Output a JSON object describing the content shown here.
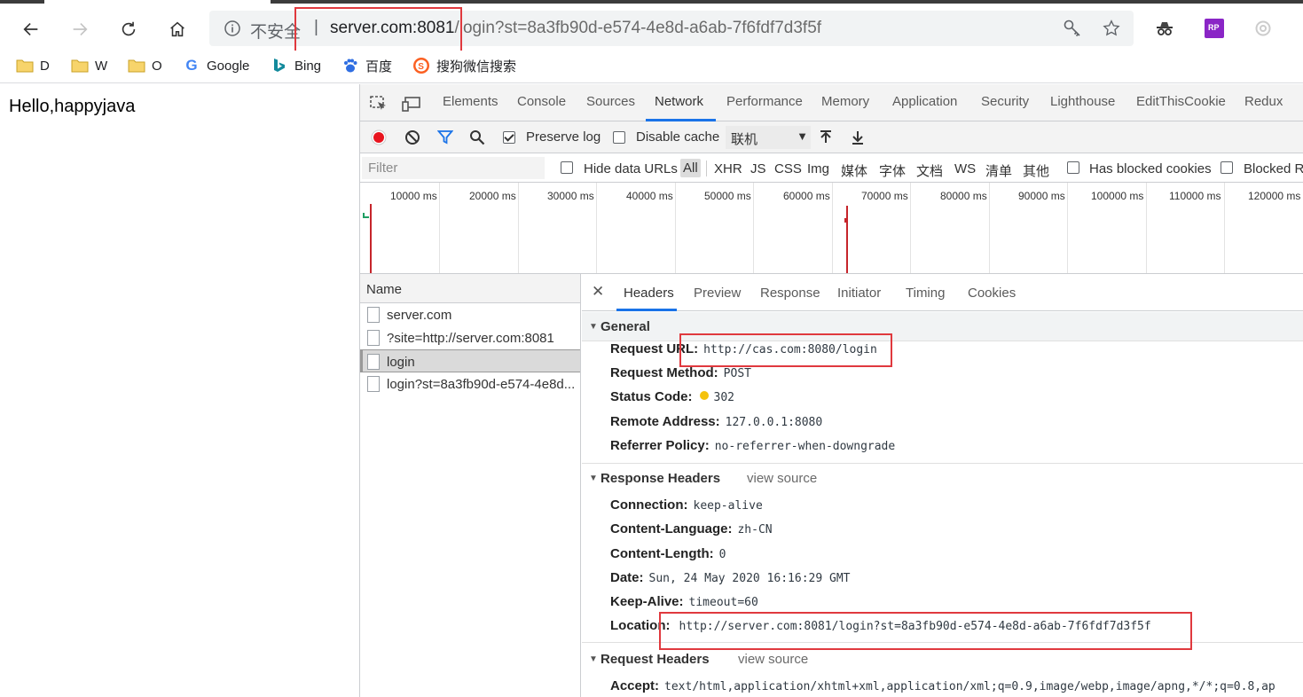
{
  "browser": {
    "address": {
      "insecure_label": "不安全",
      "separator": "|",
      "host": "server.com:8081",
      "path": "/login?st=8a3fb90d-e574-4e8d-a6ab-7f6fdf7d3f5f"
    },
    "bookmarks": [
      {
        "label": "D",
        "icon": "folder-icon"
      },
      {
        "label": "W",
        "icon": "folder-icon"
      },
      {
        "label": "O",
        "icon": "folder-icon"
      },
      {
        "label": "Google",
        "icon": "google-icon"
      },
      {
        "label": "Bing",
        "icon": "bing-icon"
      },
      {
        "label": "百度",
        "icon": "baidu-icon"
      },
      {
        "label": "搜狗微信搜索",
        "icon": "sogou-icon"
      }
    ],
    "extensions": {
      "ext2_badge": "RP"
    }
  },
  "page": {
    "text": "Hello,happyjava"
  },
  "devtools": {
    "tabs": [
      "Elements",
      "Console",
      "Sources",
      "Network",
      "Performance",
      "Memory",
      "Application",
      "Security",
      "Lighthouse",
      "EditThisCookie",
      "Redux"
    ],
    "active_tab": "Network",
    "toolbar": {
      "preserve_log": "Preserve log",
      "preserve_log_checked": true,
      "disable_cache": "Disable cache",
      "disable_cache_checked": false,
      "throttling": "联机"
    },
    "filter": {
      "placeholder": "Filter",
      "hide_data_urls": "Hide data URLs",
      "types": [
        "All",
        "XHR",
        "JS",
        "CSS",
        "Img",
        "媒体",
        "字体",
        "文档",
        "WS",
        "清单",
        "其他"
      ],
      "has_blocked_cookies": "Has blocked cookies",
      "blocked_requests": "Blocked Re"
    },
    "timeline": {
      "ticks": [
        "10000 ms",
        "20000 ms",
        "30000 ms",
        "40000 ms",
        "50000 ms",
        "60000 ms",
        "70000 ms",
        "80000 ms",
        "90000 ms",
        "100000 ms",
        "110000 ms",
        "120000 ms"
      ]
    },
    "requests": {
      "header": "Name",
      "rows": [
        {
          "name": "server.com"
        },
        {
          "name": "?site=http://server.com:8081"
        },
        {
          "name": "login"
        },
        {
          "name": "login?st=8a3fb90d-e574-4e8d..."
        }
      ],
      "selected_index": 2
    },
    "details": {
      "tabs": [
        "Headers",
        "Preview",
        "Response",
        "Initiator",
        "Timing",
        "Cookies"
      ],
      "active_tab": "Headers",
      "general": {
        "title": "General",
        "items": [
          {
            "key": "Request URL:",
            "value": "http://cas.com:8080/login"
          },
          {
            "key": "Request Method:",
            "value": "POST"
          },
          {
            "key": "Status Code:",
            "value": "302",
            "status_color": "#f4c20d"
          },
          {
            "key": "Remote Address:",
            "value": "127.0.0.1:8080"
          },
          {
            "key": "Referrer Policy:",
            "value": "no-referrer-when-downgrade"
          }
        ]
      },
      "response_headers": {
        "title": "Response Headers",
        "view_source": "view source",
        "items": [
          {
            "key": "Connection:",
            "value": "keep-alive"
          },
          {
            "key": "Content-Language:",
            "value": "zh-CN"
          },
          {
            "key": "Content-Length:",
            "value": "0"
          },
          {
            "key": "Date:",
            "value": "Sun, 24 May 2020 16:16:29 GMT"
          },
          {
            "key": "Keep-Alive:",
            "value": "timeout=60"
          },
          {
            "key": "Location:",
            "value": "http://server.com:8081/login?st=8a3fb90d-e574-4e8d-a6ab-7f6fdf7d3f5f"
          }
        ]
      },
      "request_headers": {
        "title": "Request Headers",
        "view_source": "view source",
        "items": [
          {
            "key": "Accept:",
            "value": "text/html,application/xhtml+xml,application/xml;q=0.9,image/webp,image/apng,*/*;q=0.8,ap"
          }
        ]
      }
    }
  },
  "colors": {
    "highlight": "#e0393e",
    "active_tab": "#1a73e8",
    "record": "#e8141e",
    "filter_icon": "#1a73e8"
  }
}
